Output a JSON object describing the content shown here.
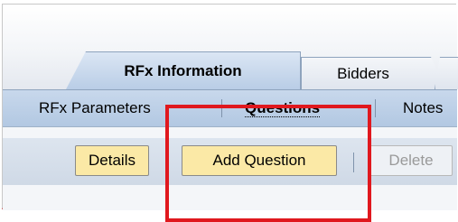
{
  "tabs": [
    {
      "label": "RFx Information",
      "active": true
    },
    {
      "label": "Bidders",
      "active": false
    }
  ],
  "subnav": {
    "items": [
      {
        "label": "RFx Parameters",
        "active": false
      },
      {
        "label": "Questions",
        "active": true
      },
      {
        "label": "Notes",
        "active": false
      }
    ]
  },
  "toolbar": {
    "details_label": "Details",
    "add_question_label": "Add Question",
    "delete_label": "Delete",
    "delete_enabled": false
  },
  "colors": {
    "highlight": "#e0181e",
    "button_bg": "#fbe9a6",
    "subnav_bg": "#b9cde6"
  }
}
